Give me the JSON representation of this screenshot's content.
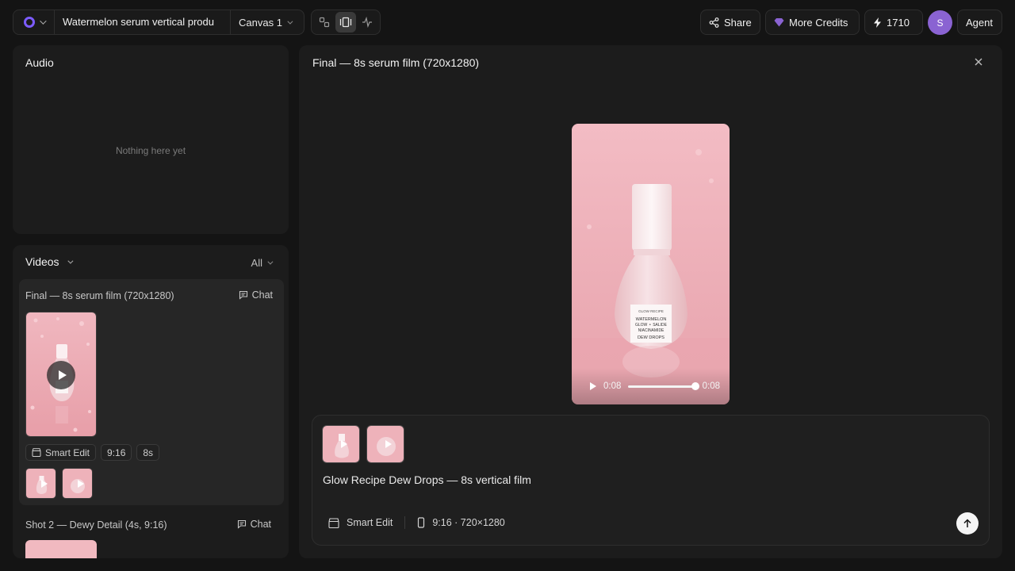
{
  "topbar": {
    "project_title": "Watermelon serum vertical produ",
    "canvas_label": "Canvas 1",
    "share_label": "Share",
    "credits_label": "More Credits",
    "credit_balance": "1710",
    "avatar_initial": "S",
    "agent_label": "Agent",
    "accent_color": "#7c5cff"
  },
  "audio": {
    "title": "Audio",
    "empty_text": "Nothing here yet"
  },
  "videos": {
    "title": "Videos",
    "filter_label": "All",
    "items": [
      {
        "title": "Final — 8s serum film (720x1280)",
        "chat_label": "Chat",
        "chips": [
          "Smart Edit",
          "9:16",
          "8s"
        ]
      },
      {
        "title": "Shot 2 — Dewy Detail (4s, 9:16)",
        "chat_label": "Chat"
      }
    ]
  },
  "preview": {
    "title": "Final — 8s serum film (720x1280)",
    "bottle_label": [
      "GLOW RECIPE",
      "WATERMELON",
      "GLOW ⚬ SALIDE",
      "NIACINAMIDE",
      "DEW DROPS"
    ],
    "current_time": "0:08",
    "duration": "0:08",
    "progress": 1.0
  },
  "composer": {
    "prompt_text": "Glow Recipe Dew Drops — 8s vertical film",
    "smart_edit_label": "Smart Edit",
    "format_label": "9:16 · 720×1280"
  }
}
